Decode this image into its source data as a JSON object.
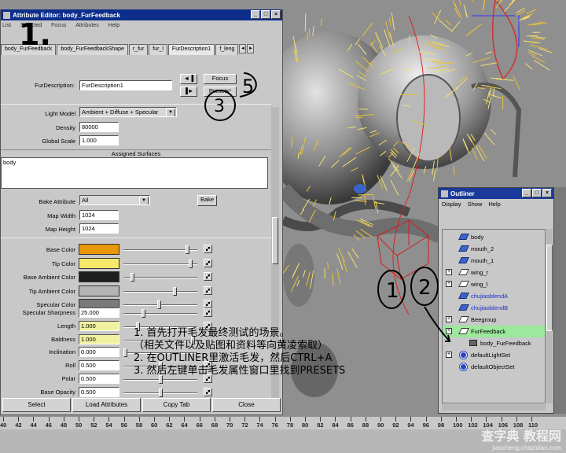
{
  "attribute_editor": {
    "title": "Attribute Editor: body_FurFeedback",
    "menu": [
      "List",
      "Selected",
      "Focus",
      "Attributes",
      "Help"
    ],
    "tabs": [
      "body_FurFeedback",
      "body_FurFeedbackShape",
      "r_fur",
      "fur_l",
      "FurDescription1",
      "f_leng"
    ],
    "active_tab": "FurDescription1",
    "furdesc_label": "FurDescription:",
    "furdesc_value": "FurDescription1",
    "focus_label": "Focus",
    "presets_label": "Presets*",
    "light_model_label": "Light Model",
    "light_model_value": "Ambient + Diffuse + Specular",
    "density_label": "Density",
    "density_value": "80000",
    "global_scale_label": "Global Scale",
    "global_scale_value": "1.000",
    "assigned_surfaces_label": "Assigned Surfaces",
    "assigned_surface": "body",
    "bake_attr_label": "Bake Attribute",
    "bake_attr_value": "All",
    "bake_label": "Bake",
    "map_width_label": "Map Width",
    "map_width_value": "1024",
    "map_height_label": "Map Height",
    "map_height_value": "1024",
    "colors": [
      {
        "label": "Base Color",
        "hex": "#e8960a",
        "level": 0.88
      },
      {
        "label": "Tip Color",
        "hex": "#f6e86a",
        "level": 0.92
      },
      {
        "label": "Base Ambient Color",
        "hex": "#1e1e1e",
        "level": 0.1
      },
      {
        "label": "Tip Ambient Color",
        "hex": "#b5b5b5",
        "level": 0.7
      },
      {
        "label": "Specular Color",
        "hex": "#7a7a7a",
        "level": 0.48
      }
    ],
    "numeric": [
      {
        "label": "Specular Sharpness",
        "value": "25.000",
        "level": 0.25,
        "yellow": false
      },
      {
        "label": "Length",
        "value": "1.000",
        "level": 0.18,
        "yellow": true
      },
      {
        "label": "Baldness",
        "value": "1.000",
        "level": 0.95,
        "yellow": true
      },
      {
        "label": "Inclination",
        "value": "0.000",
        "level": 0.0,
        "yellow": false
      },
      {
        "label": "Roll",
        "value": "0.500",
        "level": 0.5,
        "yellow": false
      },
      {
        "label": "Polar",
        "value": "0.500",
        "level": 0.5,
        "yellow": false
      },
      {
        "label": "Base Opacity",
        "value": "0.500",
        "level": 0.5,
        "yellow": false
      }
    ],
    "footer": [
      "Select",
      "Load Attributes",
      "Copy Tab",
      "Close"
    ]
  },
  "outliner": {
    "title": "Outliner",
    "menu": [
      "Display",
      "Show",
      "Help"
    ],
    "items": [
      {
        "label": "body",
        "icon": "blue",
        "expand": false,
        "blue": false,
        "sel": false
      },
      {
        "label": "mouth_2",
        "icon": "blue",
        "expand": false,
        "blue": false,
        "sel": false
      },
      {
        "label": "mouth_1",
        "icon": "blue",
        "expand": false,
        "blue": false,
        "sel": false
      },
      {
        "label": "wing_r",
        "icon": "plane",
        "expand": true,
        "blue": false,
        "sel": false
      },
      {
        "label": "wing_l",
        "icon": "plane",
        "expand": true,
        "blue": false,
        "sel": false
      },
      {
        "label": "chujiaoblendA",
        "icon": "blue",
        "expand": false,
        "blue": true,
        "sel": false
      },
      {
        "label": "chujiaoblendB",
        "icon": "blue",
        "expand": false,
        "blue": true,
        "sel": false
      },
      {
        "label": "Beegroup",
        "icon": "plane",
        "expand": true,
        "blue": false,
        "sel": false
      },
      {
        "label": "FurFeedback",
        "icon": "plane",
        "expand": true,
        "blue": false,
        "sel": true
      },
      {
        "label": "body_FurFeedback",
        "icon": "fur",
        "expand": false,
        "blue": false,
        "sel": false,
        "indent": true
      },
      {
        "label": "defaultLightSet",
        "icon": "set",
        "expand": true,
        "blue": false,
        "sel": false
      },
      {
        "label": "defaultObjectSet",
        "icon": "set",
        "expand": false,
        "blue": false,
        "sel": false
      }
    ]
  },
  "timeline": {
    "ticks": [
      "40",
      "42",
      "44",
      "46",
      "48",
      "50",
      "52",
      "54",
      "56",
      "58",
      "60",
      "62",
      "64",
      "66",
      "68",
      "70",
      "72",
      "74",
      "76",
      "78",
      "80",
      "82",
      "84",
      "86",
      "88",
      "90",
      "92",
      "94",
      "96",
      "98",
      "100",
      "102",
      "104",
      "106",
      "108",
      "110"
    ]
  },
  "annotations": {
    "step_main": "1.",
    "mark_3": "3",
    "mark_5": "5",
    "mark_1": "1",
    "mark_2": "2",
    "instructions": [
      "1. 首先打开毛发最终测试的场景。",
      "（相关文件以及贴图和资料等向黄凌索取）",
      "2. 在OUTLINER里激活毛发，然后CTRL+A",
      "3. 然后左键单击毛发属性窗口里找到PRESETS"
    ]
  },
  "watermark": {
    "brand": "查字典 教程网",
    "url": "jiaocheng.chazidian.com"
  }
}
